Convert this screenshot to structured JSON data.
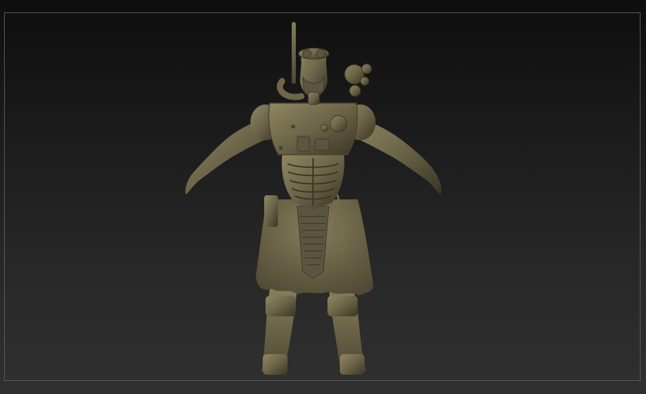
{
  "viewport": {
    "background_top": "#0e0e0e",
    "background_bottom": "#303030",
    "frame_color": "#5a5a5a"
  },
  "model": {
    "material_color": "#6b6448",
    "highlight_color": "#8f8762",
    "shadow_color": "#3a3525",
    "icon": "sculpted-character-model"
  }
}
